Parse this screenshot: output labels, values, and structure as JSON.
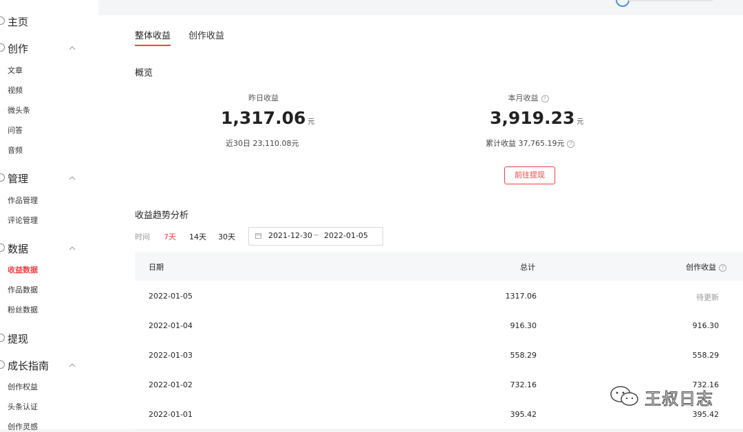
{
  "sidebar": {
    "home": "主页",
    "sections": [
      {
        "title": "创作",
        "items": [
          "文章",
          "视频",
          "微头条",
          "问答",
          "音频"
        ]
      },
      {
        "title": "管理",
        "items": [
          "作品管理",
          "评论管理"
        ]
      },
      {
        "title": "数据",
        "items": [
          "收益数据",
          "作品数据",
          "粉丝数据"
        ]
      },
      {
        "title": "提现",
        "items": []
      },
      {
        "title": "成长指南",
        "items": [
          "创作权益",
          "头条认证",
          "创作灵感"
        ]
      }
    ],
    "active_item": "收益数据"
  },
  "tabs": [
    "整体收益",
    "创作收益"
  ],
  "overview": {
    "heading": "概览",
    "yesterday": {
      "label": "昨日收益",
      "value": "1,317.06",
      "unit": "元",
      "sub": "近30日 23,110.08元"
    },
    "month": {
      "label": "本月收益",
      "value": "3,919.23",
      "unit": "元",
      "sub": "累计收益 37,765.19元"
    },
    "withdraw_button": "前往提现"
  },
  "trend": {
    "heading": "收益趋势分析",
    "range_label": "时间",
    "ranges": [
      "7天",
      "14天",
      "30天"
    ],
    "active_range": "7天",
    "date_from": "2021-12-30",
    "date_sep": "~",
    "date_to": "2022-01-05"
  },
  "table": {
    "headers": [
      "日期",
      "总计",
      "创作收益"
    ],
    "rows": [
      [
        "2022-01-05",
        "1317.06",
        "待更新"
      ],
      [
        "2022-01-04",
        "916.30",
        "916.30"
      ],
      [
        "2022-01-03",
        "558.29",
        "558.29"
      ],
      [
        "2022-01-02",
        "732.16",
        "732.16"
      ],
      [
        "2022-01-01",
        "395.42",
        "395.42"
      ]
    ]
  },
  "watermark": "王叔日志",
  "colors": {
    "accent": "#f04142",
    "background": "#f4f5f6"
  }
}
